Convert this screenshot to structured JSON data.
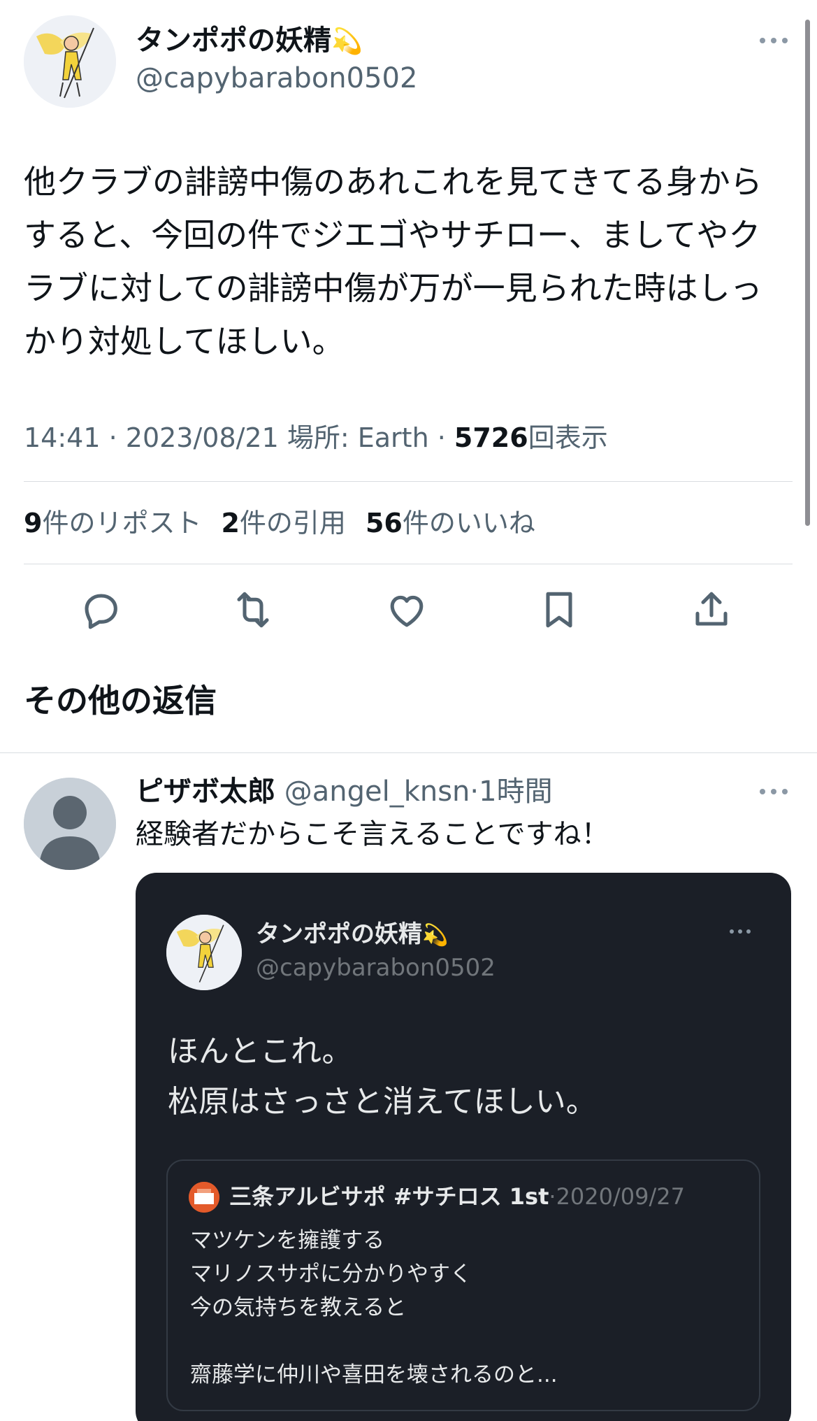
{
  "tweet": {
    "display_name": "タンポポの妖精",
    "name_emoji": "💫",
    "handle": "@capybarabon0502",
    "text_lines": [
      "他クラブの誹謗中傷のあれこれを見てきてる身から",
      "すると、今回の件でジエゴやサチロー、ましてやク",
      "ラブに対しての誹謗中傷が万が一見られた時はしっ",
      "かり対処してほしい。"
    ],
    "meta": {
      "time": "14:41",
      "sep1": " · ",
      "date": "2023/08/21",
      "location_label": " 場所: ",
      "location": "Earth",
      "sep2": " · ",
      "views": "5726",
      "views_label": "回表示"
    },
    "stats": {
      "reposts": "9",
      "reposts_label": "件のリポスト",
      "quotes": "2",
      "quotes_label": "件の引用",
      "likes": "56",
      "likes_label": "件のいいね"
    },
    "actions": [
      "reply-icon",
      "repost-icon",
      "like-icon",
      "bookmark-icon",
      "share-icon"
    ]
  },
  "section_title": "その他の返信",
  "reply": {
    "display_name": "ピザボ太郎",
    "handle": "@angel_knsn",
    "sep": "·",
    "time": "1時間",
    "text": "経験者だからこそ言えることですね！",
    "embedded": {
      "display_name": "タンポポの妖精",
      "name_emoji": "💫",
      "handle": "@capybarabon0502",
      "text_lines": [
        "ほんとこれ。",
        "松原はさっさと消えてほしい。"
      ],
      "quote": {
        "display_name": "三条アルビサポ #サチロス 1st",
        "sep": "·",
        "date": "2020/09/27",
        "text_lines": [
          "マツケンを擁護する",
          "マリノスサポに分かりやすく",
          "今の気持ちを教えると",
          "",
          "齋藤学に仲川や喜田を壊されるのと..."
        ]
      }
    }
  },
  "colors": {
    "text_primary": "#0f1419",
    "text_secondary": "#536471",
    "dark_card": "#1b1f27",
    "accent_emoji": "#f2b705"
  }
}
